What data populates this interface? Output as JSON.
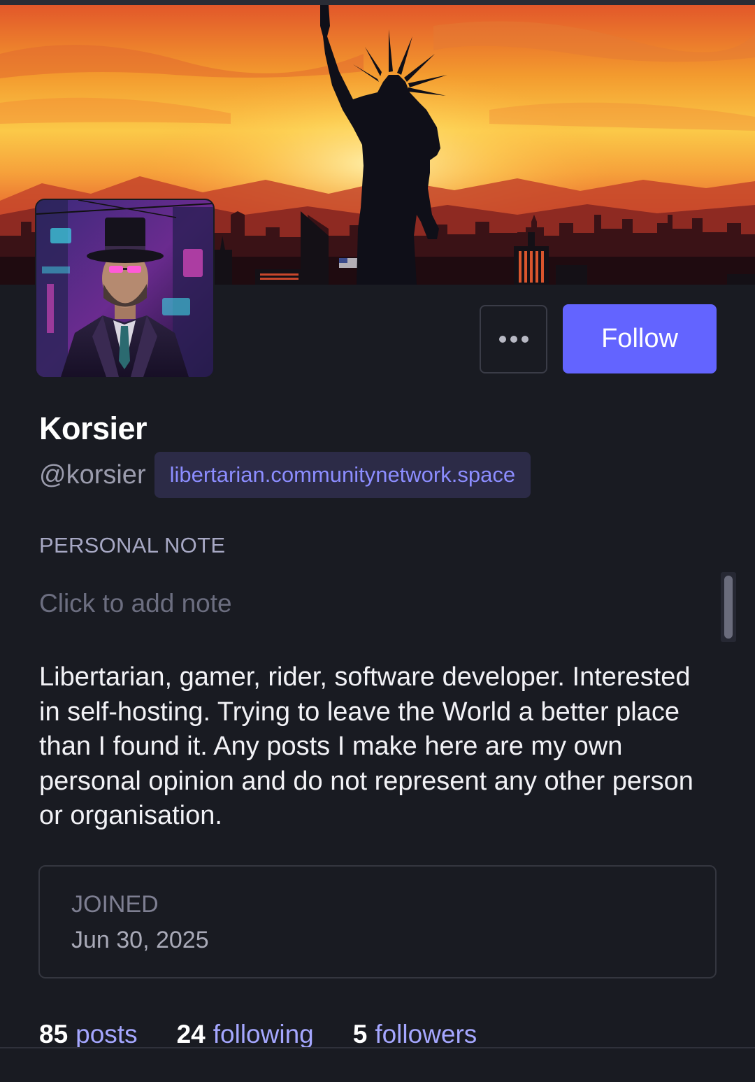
{
  "profile": {
    "display_name": "Korsier",
    "handle": "@korsier",
    "domain": "libertarian.communitynetwork.space",
    "bio": "Libertarian, gamer, rider, software developer. Interested in self-hosting. Trying to leave the World a better place than I found it. Any posts I make here are my own personal opinion and do not represent any other person or organisation."
  },
  "actions": {
    "more_icon": "ellipsis-icon",
    "follow_label": "Follow"
  },
  "note": {
    "heading": "PERSONAL NOTE",
    "placeholder": "Click to add note"
  },
  "joined": {
    "label": "JOINED",
    "date": "Jun 30, 2025"
  },
  "stats": {
    "posts_count": "85",
    "posts_label": "posts",
    "following_count": "24",
    "following_label": "following",
    "followers_count": "5",
    "followers_label": "followers"
  },
  "colors": {
    "background": "#191b22",
    "accent": "#6364ff",
    "link": "#a5a7ff",
    "badge_bg": "#2c2b47",
    "badge_text": "#8c8dff"
  }
}
